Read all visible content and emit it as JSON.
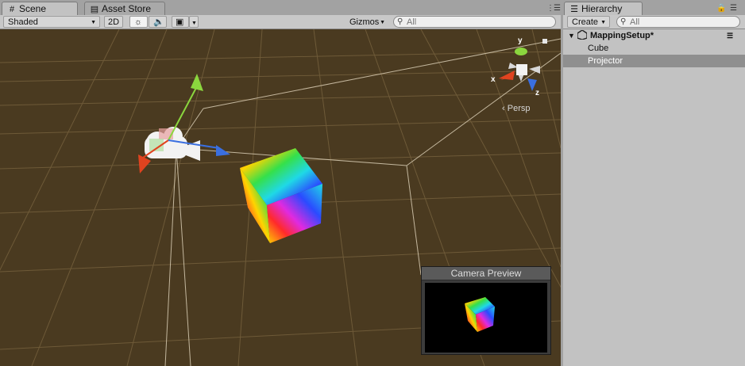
{
  "scene_panel": {
    "tabs": [
      {
        "icon": "grid-icon",
        "label": "Scene"
      },
      {
        "icon": "store-icon",
        "label": "Asset Store"
      }
    ],
    "toolbar": {
      "shading_mode": "Shaded",
      "mode_2d": "2D",
      "lighting_icon": "sun-icon",
      "audio_icon": "speaker-icon",
      "effects_icon": "image-icon",
      "gizmos_label": "Gizmos",
      "search_placeholder": "All"
    },
    "viewport": {
      "orientation_label": "Persp",
      "axis_labels": {
        "x": "x",
        "y": "y",
        "z": "z"
      },
      "preview_title": "Camera Preview"
    }
  },
  "hierarchy_panel": {
    "tab_label": "Hierarchy",
    "tab_icon": "list-icon",
    "create_label": "Create",
    "search_placeholder": "All",
    "scene_name": "MappingSetup*",
    "items": [
      {
        "label": "Cube",
        "selected": false
      },
      {
        "label": "Projector",
        "selected": true
      }
    ]
  },
  "colors": {
    "viewport_bg": "#4a3a20",
    "grid_line": "#6e5a38",
    "selection": "#8f8f8f",
    "x_axis": "#e0431f",
    "y_axis": "#8bd63e",
    "z_axis": "#3a6fe0"
  }
}
